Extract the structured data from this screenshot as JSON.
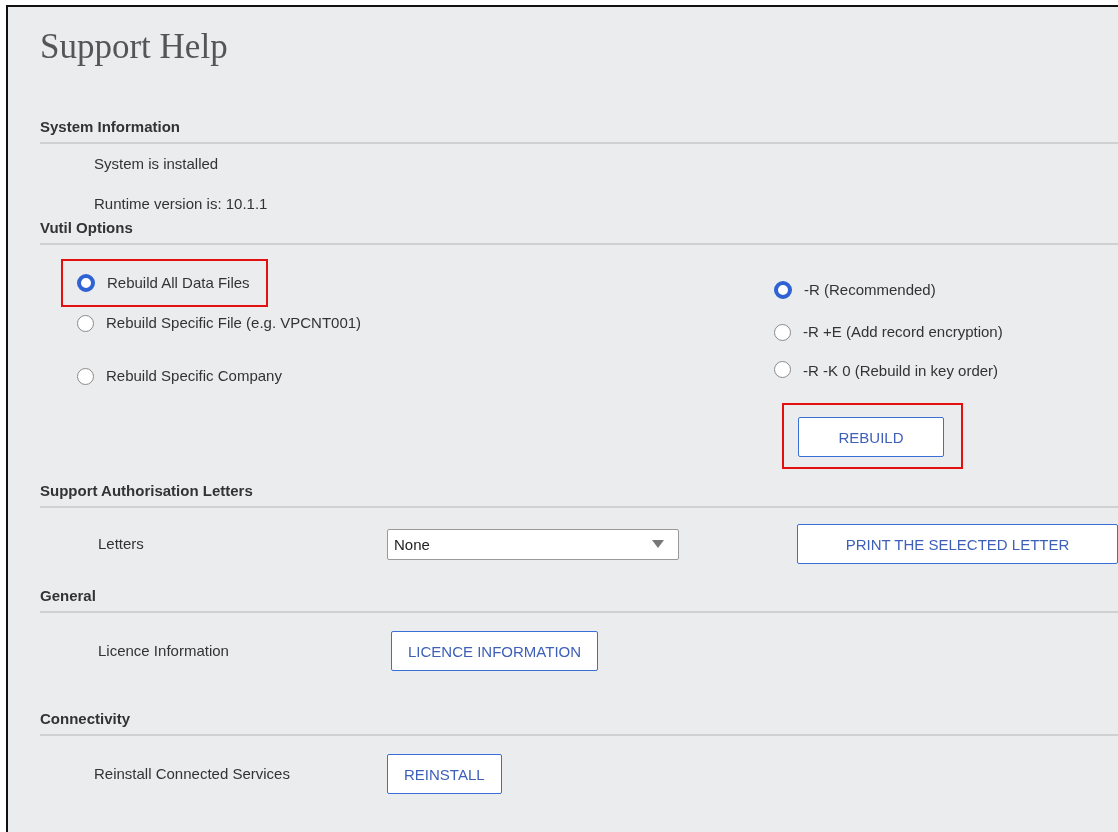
{
  "title": "Support Help",
  "sections": [
    {
      "kind": "info",
      "heading": "System Information",
      "lines": [
        "System is installed",
        "Runtime version is: 10.1.1"
      ]
    },
    {
      "kind": "options",
      "heading": "Vutil Options",
      "scope_options": [
        {
          "label": "Rebuild All Data Files",
          "selected": true,
          "highlighted": true
        },
        {
          "label": "Rebuild Specific File (e.g. VPCNT001)",
          "selected": false,
          "highlighted": false
        },
        {
          "label": "Rebuild Specific Company",
          "selected": false,
          "highlighted": false
        }
      ],
      "mode_options": [
        {
          "label": "-R (Recommended)",
          "selected": true
        },
        {
          "label": "-R +E (Add record encryption)",
          "selected": false
        },
        {
          "label": "-R -K 0 (Rebuild in key order)",
          "selected": false
        }
      ],
      "button": {
        "label": "REBUILD",
        "highlighted": true
      }
    },
    {
      "kind": "select",
      "heading": "Support Authorisation Letters",
      "label": "Letters",
      "select": {
        "value": "None"
      },
      "button": {
        "label": "PRINT THE SELECTED LETTER"
      }
    },
    {
      "kind": "action",
      "heading": "General",
      "label": "Licence Information",
      "button": {
        "label": "LICENCE INFORMATION"
      }
    },
    {
      "kind": "action",
      "heading": "Connectivity",
      "label": "Reinstall Connected Services",
      "button": {
        "label": "REINSTALL"
      }
    }
  ]
}
